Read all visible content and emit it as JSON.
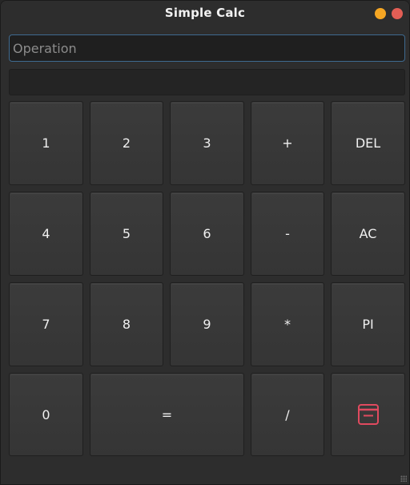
{
  "window": {
    "title": "Simple Calc"
  },
  "operation_input": {
    "value": "",
    "placeholder": "Operation"
  },
  "result_display": {
    "value": ""
  },
  "keys": {
    "k1": "1",
    "k2": "2",
    "k3": "3",
    "plus": "+",
    "del": "DEL",
    "k4": "4",
    "k5": "5",
    "k6": "6",
    "minus": "-",
    "ac": "AC",
    "k7": "7",
    "k8": "8",
    "k9": "9",
    "multiply": "*",
    "pi": "PI",
    "k0": "0",
    "equals": "=",
    "divide": "/",
    "last_key_icon": "calendar-minus-icon"
  },
  "colors": {
    "minimize_button": "#f5a623",
    "close_button": "#e35e55",
    "icon_accent": "#e04a5f",
    "input_focus_border": "#3e6a8f"
  }
}
